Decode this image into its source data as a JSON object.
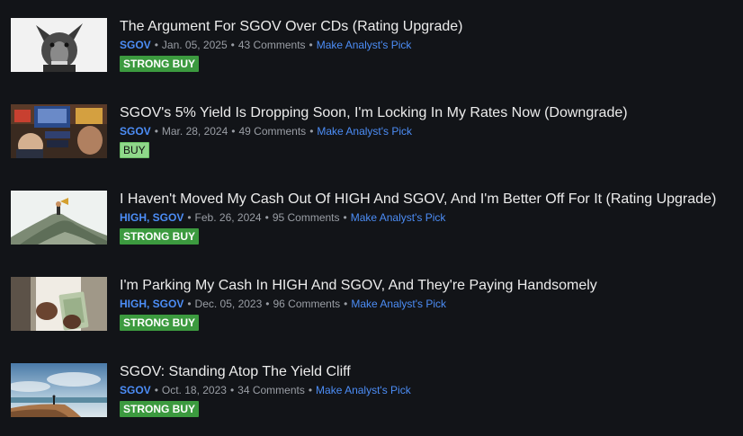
{
  "articles": [
    {
      "title": "The Argument For SGOV Over CDs (Rating Upgrade)",
      "tickers": "SGOV",
      "date": "Jan. 05, 2025",
      "comments": "43 Comments",
      "pick_label": "Make Analyst's Pick",
      "rating": "STRONG BUY",
      "thumb_icon": "dog-photo-icon"
    },
    {
      "title": "SGOV's 5% Yield Is Dropping Soon, I'm Locking In My Rates Now (Downgrade)",
      "tickers": "SGOV",
      "date": "Mar. 28, 2024",
      "comments": "49 Comments",
      "pick_label": "Make Analyst's Pick",
      "rating": "BUY",
      "thumb_icon": "trading-floor-photo-icon"
    },
    {
      "title": "I Haven't Moved My Cash Out Of HIGH And SGOV, And I'm Better Off For It (Rating Upgrade)",
      "tickers": "HIGH, SGOV",
      "date": "Feb. 26, 2024",
      "comments": "95 Comments",
      "pick_label": "Make Analyst's Pick",
      "rating": "STRONG BUY",
      "thumb_icon": "money-pile-photo-icon"
    },
    {
      "title": "I'm Parking My Cash In HIGH And SGOV, And They're Paying Handsomely",
      "tickers": "HIGH, SGOV",
      "date": "Dec. 05, 2023",
      "comments": "96 Comments",
      "pick_label": "Make Analyst's Pick",
      "rating": "STRONG BUY",
      "thumb_icon": "cash-in-hand-photo-icon"
    },
    {
      "title": "SGOV: Standing Atop The Yield Cliff",
      "tickers": "SGOV",
      "date": "Oct. 18, 2023",
      "comments": "34 Comments",
      "pick_label": "Make Analyst's Pick",
      "rating": "STRONG BUY",
      "thumb_icon": "cliff-landscape-photo-icon"
    }
  ],
  "colors": {
    "background": "#121418",
    "title": "#ececec",
    "link": "#4c8df6",
    "meta": "#9a9ea5",
    "strong_buy": "#3c9a3f",
    "buy": "#8fd88a"
  }
}
